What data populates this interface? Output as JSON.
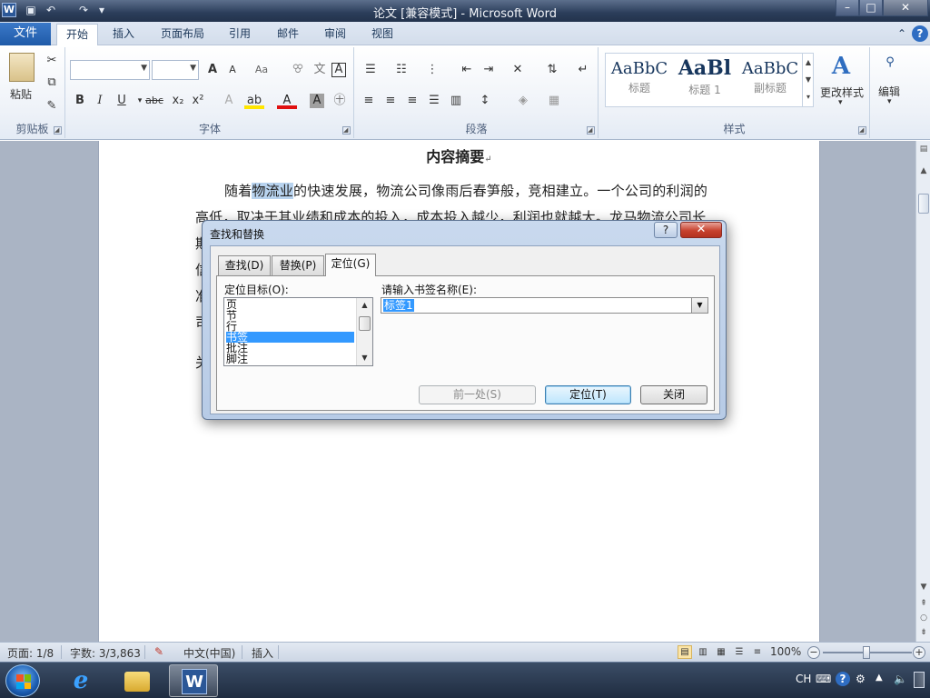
{
  "window": {
    "title": "论文 [兼容模式] - Microsoft Word",
    "app_icon": "W",
    "minimize": "–",
    "maximize": "□",
    "close": "✕"
  },
  "ribbon_tabs": [
    {
      "label": "文件"
    },
    {
      "label": "开始"
    },
    {
      "label": "插入"
    },
    {
      "label": "页面布局"
    },
    {
      "label": "引用"
    },
    {
      "label": "邮件"
    },
    {
      "label": "审阅"
    },
    {
      "label": "视图"
    }
  ],
  "ribbon": {
    "clipboard": {
      "label": "剪贴板",
      "paste": "粘贴"
    },
    "font": {
      "label": "字体",
      "bold": "B",
      "italic": "I",
      "underline": "U",
      "strike": "abc",
      "sub": "x₂",
      "sup": "x²",
      "grow": "A",
      "shrink": "A",
      "case": "Aa"
    },
    "paragraph": {
      "label": "段落"
    },
    "styles": {
      "label": "样式",
      "items": [
        {
          "preview": "AaBbC",
          "name": "标题"
        },
        {
          "preview": "AaBl",
          "name": "标题 1"
        },
        {
          "preview": "AaBbC",
          "name": "副标题"
        }
      ],
      "change_styles": "更改样式"
    },
    "editing": {
      "label": "编辑"
    }
  },
  "document": {
    "title": "内容摘要",
    "line1_pre": "随着",
    "line1_hl": "物流业",
    "line1_post": "的快速发展，物流公司像雨后春笋般，竞相建立。一个公司的利润的",
    "line2": "高低，取决于其业绩和成本的投入，成本投入越少，利润也就越大。龙马物流公司长",
    "frag_ju": "期",
    "frag_xin": "信",
    "frag_zhun": "准",
    "frag_si": "司",
    "frag_guan": "关"
  },
  "dialog": {
    "title": "查找和替换",
    "help": "?",
    "close": "✕",
    "tabs": [
      {
        "label": "查找(D)"
      },
      {
        "label": "替换(P)"
      },
      {
        "label": "定位(G)"
      }
    ],
    "target_label": "定位目标(O):",
    "targets": [
      "页",
      "节",
      "行",
      "书签",
      "批注",
      "脚注"
    ],
    "selected_target": "书签",
    "bookmark_label": "请输入书签名称(E):",
    "bookmark_value": "标签1",
    "buttons": {
      "previous": "前一处(S)",
      "goto": "定位(T)",
      "close": "关闭"
    }
  },
  "statusbar": {
    "page": "页面: 1/8",
    "words": "字数: 3/3,863",
    "language": "中文(中国)",
    "mode": "插入",
    "zoom": "100%",
    "zoom_minus": "−",
    "zoom_plus": "+"
  },
  "taskbar": {
    "lang": "CH",
    "apps": [
      "internet-explorer",
      "file-explorer",
      "word"
    ]
  },
  "colors": {
    "accent": "#2b5797",
    "selection": "#3399ff",
    "file_tab": "#1f5aa8"
  }
}
